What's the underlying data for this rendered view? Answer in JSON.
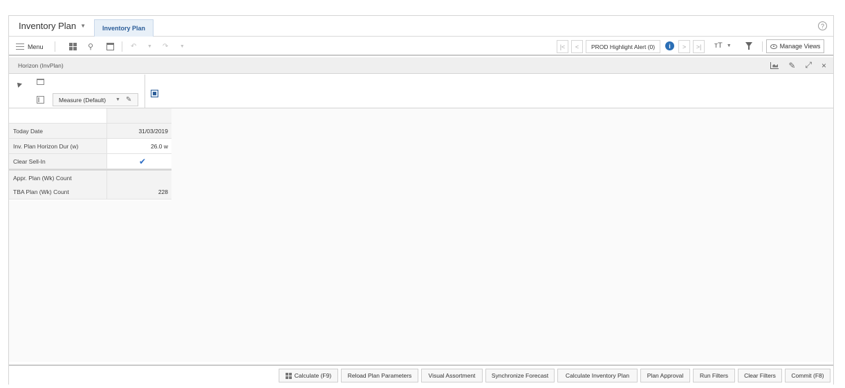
{
  "app": {
    "title": "Inventory Plan",
    "active_tab": "Inventory Plan",
    "help_icon": "help-circle-icon"
  },
  "toolbar": {
    "menu_label": "Menu",
    "alert_label": "PROD Highlight Alert (0)",
    "manage_views_label": "Manage Views"
  },
  "panel": {
    "title": "Horizon (InvPlan)",
    "measure_label": "Measure (Default)"
  },
  "grid": {
    "rows": [
      {
        "label": "Today Date",
        "value": "31/03/2019"
      },
      {
        "label": "Inv. Plan Horizon Dur (w)",
        "value": "26.0 w"
      },
      {
        "label": "Clear Sell-In",
        "value": "✔"
      },
      {
        "label": "Appr. Plan (Wk) Count",
        "value": ""
      },
      {
        "label": "TBA Plan (Wk) Count",
        "value": "228"
      }
    ]
  },
  "bottom_buttons": [
    "Calculate (F9)",
    "Reload Plan Parameters",
    "Visual Assortment",
    "Synchronize Forecast",
    "Calculate Inventory Plan",
    "Plan Approval",
    "Run Filters",
    "Clear Filters",
    "Commit (F8)"
  ],
  "colors": {
    "accent": "#2b5d98",
    "info": "#2a6eb5",
    "check": "#2b6cc4"
  }
}
